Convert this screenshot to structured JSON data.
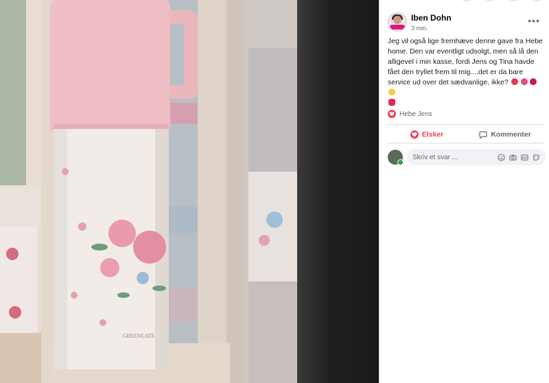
{
  "post": {
    "author": "Iben Dohn",
    "time": "3 min.",
    "more_label": "•••",
    "text": "Jeg vil også lige fremhæve denne gave fra Hebe home. Den var eventligt udsolgt, men så lå den alligevel i min kasse, fordi Jens og Tina havde fået den tryllet frem til mig....det er da bare service ud over det sædvanlige, ikke?"
  },
  "reactions": {
    "icon": "heart-reaction-icon",
    "names": "Hebe Jens"
  },
  "actions": {
    "love_label": "Elsker",
    "comment_label": "Kommenter"
  },
  "comment_box": {
    "placeholder": "Skriv et svar ...",
    "icons": [
      "emoji-icon",
      "camera-icon",
      "gif-icon",
      "sticker-icon"
    ]
  },
  "photo": {
    "brand_text": "GREENGATE"
  },
  "colors": {
    "love": "#f33e58",
    "online": "#31a24c"
  }
}
